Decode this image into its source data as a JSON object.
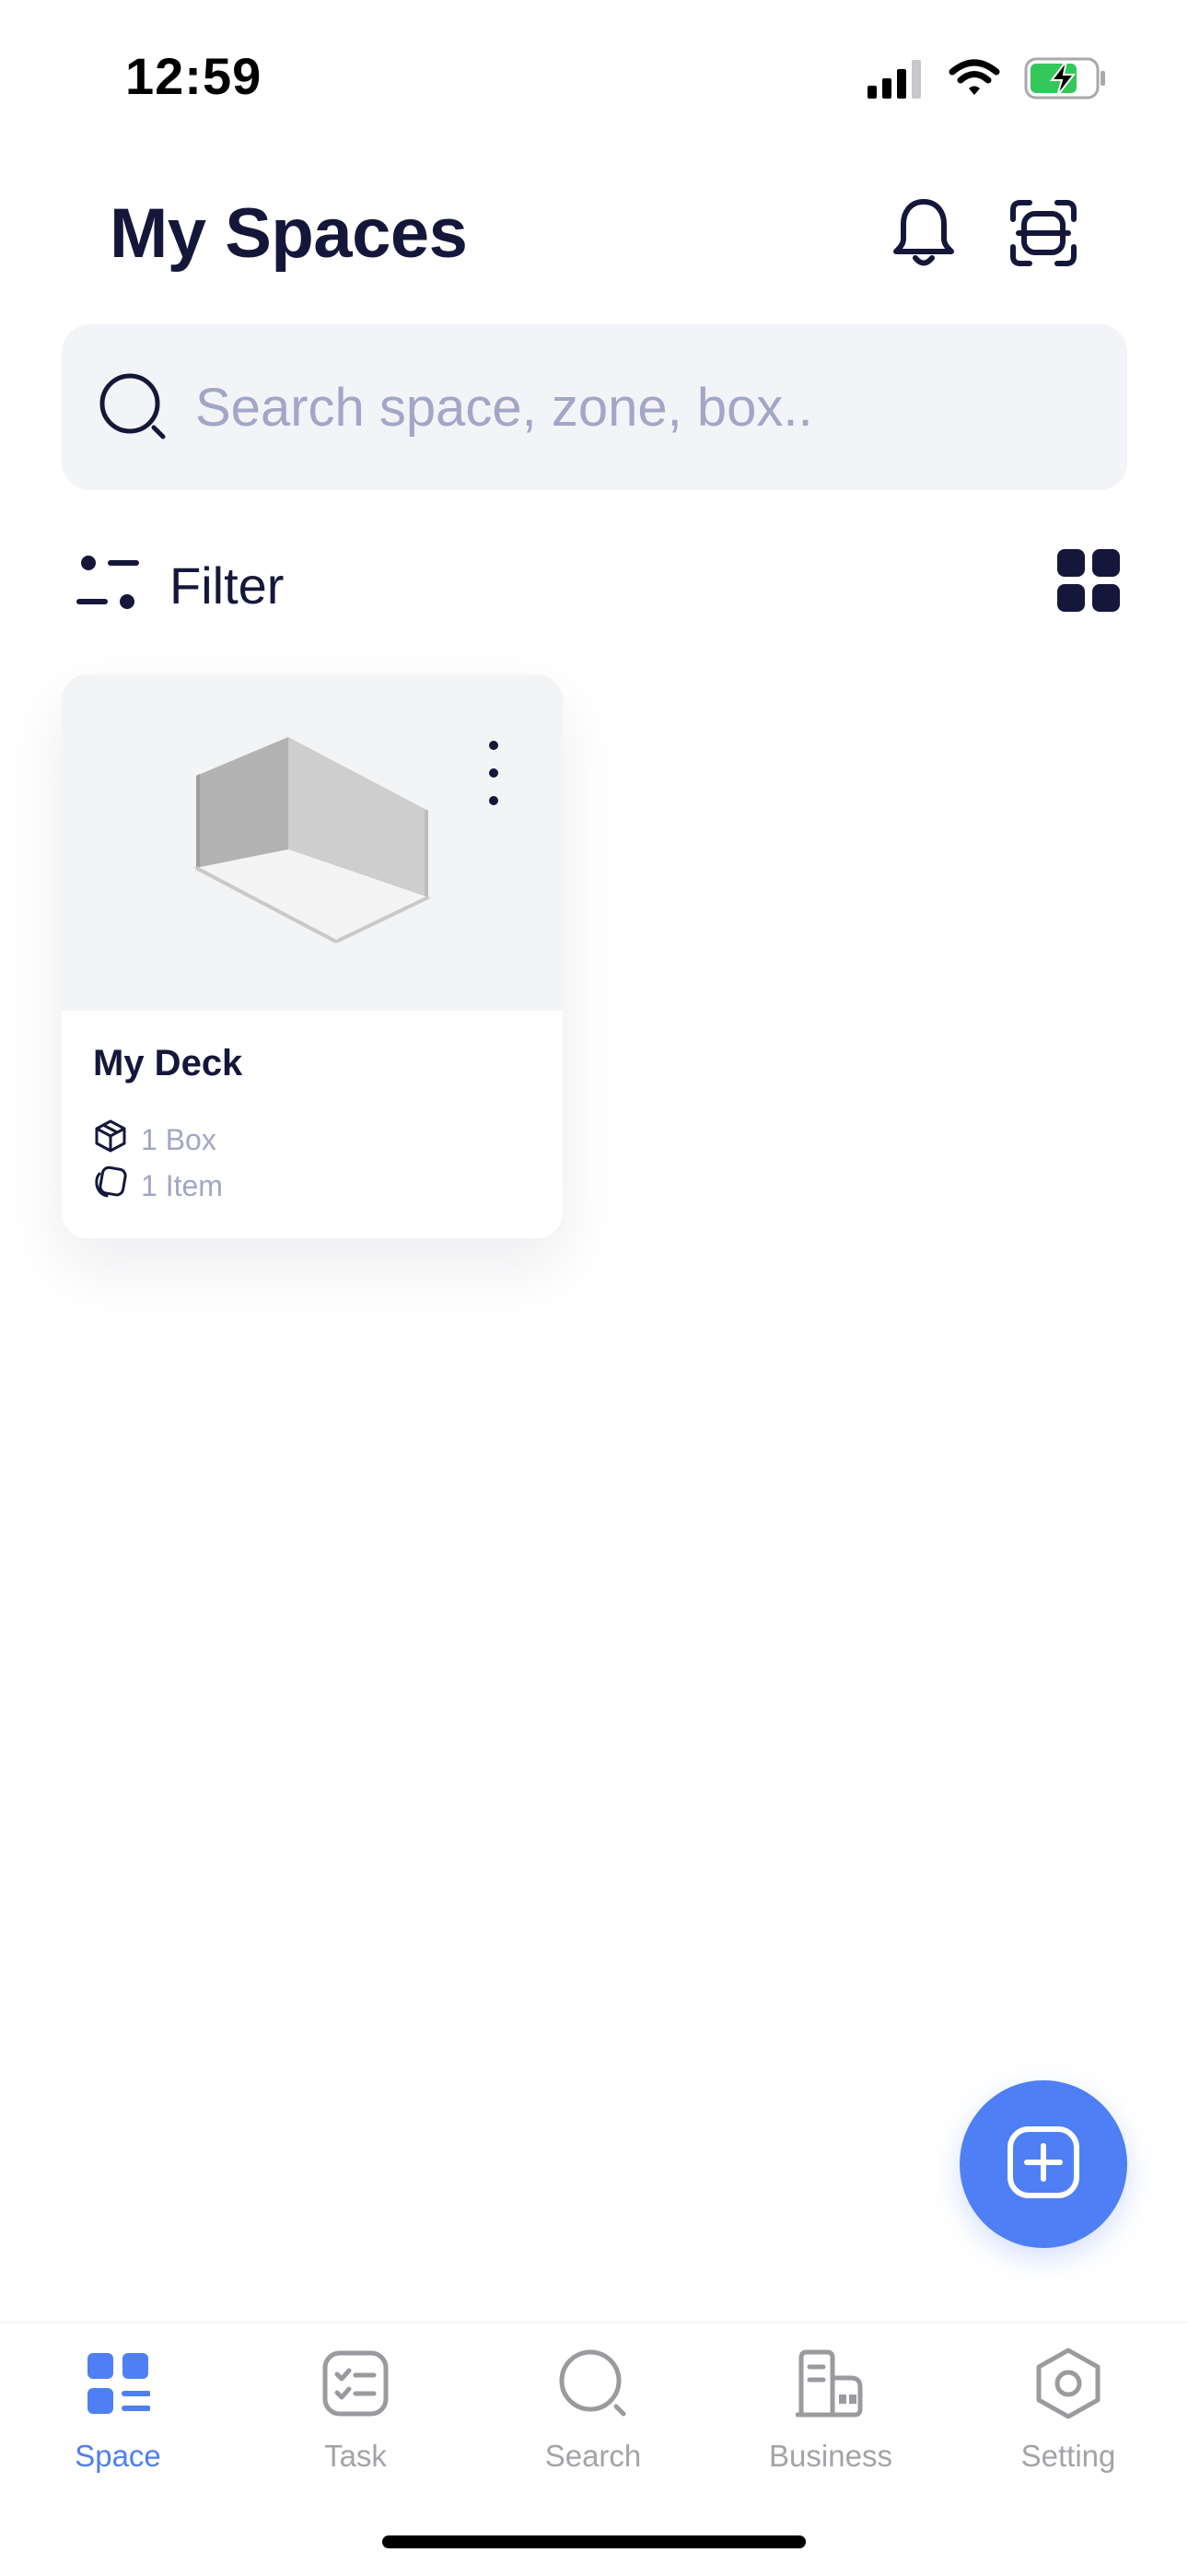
{
  "status_bar": {
    "time": "12:59",
    "icons": [
      "cellular-signal-icon",
      "wifi-icon",
      "battery-charging-icon"
    ]
  },
  "header": {
    "title": "My Spaces",
    "actions": [
      "bell-icon",
      "scan-icon"
    ]
  },
  "search": {
    "placeholder": "Search space, zone, box.."
  },
  "toolbar": {
    "filter_label": "Filter",
    "view_mode": "grid"
  },
  "spaces": [
    {
      "name": "My Deck",
      "boxes": "1 Box",
      "items": "1 Item"
    }
  ],
  "fab": {
    "icon": "plus-square-icon"
  },
  "bottom_nav": {
    "active": "Space",
    "items": [
      {
        "label": "Space",
        "icon": "space-grid-icon"
      },
      {
        "label": "Task",
        "icon": "task-checklist-icon"
      },
      {
        "label": "Search",
        "icon": "search-icon"
      },
      {
        "label": "Business",
        "icon": "business-icon"
      },
      {
        "label": "Setting",
        "icon": "setting-hexagon-icon"
      }
    ]
  },
  "colors": {
    "primary": "#4f7ff5",
    "text_dark": "#15173a",
    "text_muted": "#a3a6c6",
    "surface": "#f3f4f7",
    "nav_inactive": "#a3a3a8"
  }
}
